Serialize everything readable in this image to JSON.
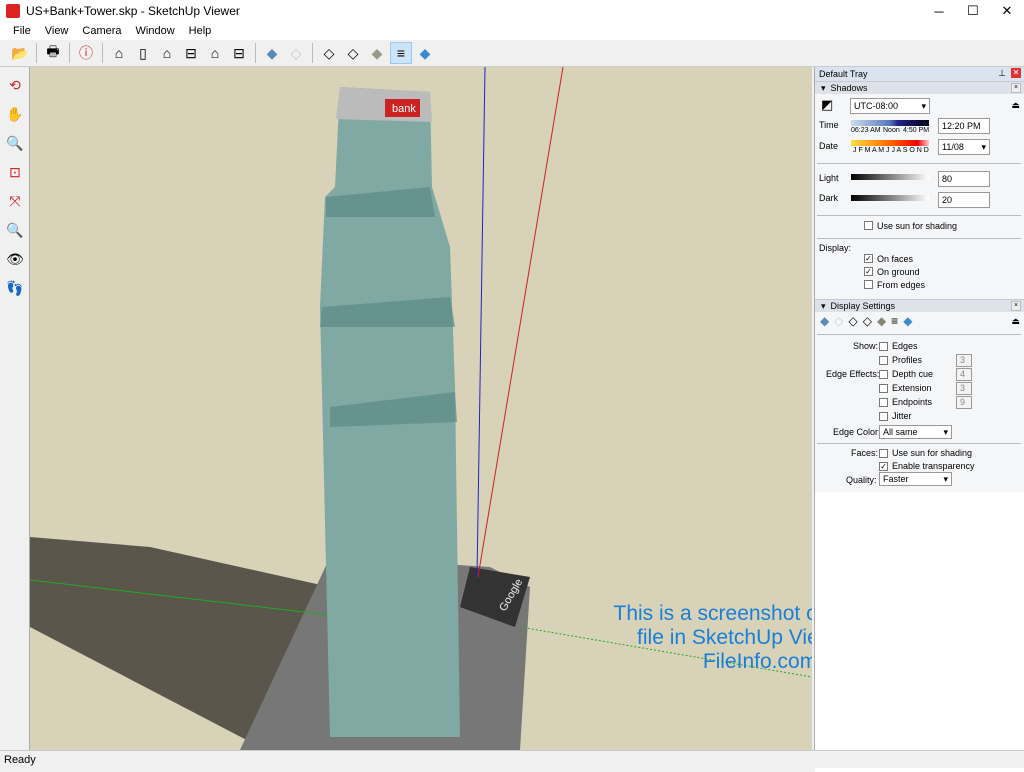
{
  "window": {
    "title": "US+Bank+Tower.skp - SketchUp Viewer",
    "minimize": "─",
    "maximize": "☐",
    "close": "✕"
  },
  "menu": [
    "File",
    "View",
    "Camera",
    "Window",
    "Help"
  ],
  "toolbar_icons": [
    "open-icon",
    "print-icon",
    "model-info-icon",
    "iso-view-icon",
    "top-view-icon",
    "front-view-icon",
    "right-view-icon",
    "back-view-icon",
    "left-view-icon",
    "xray-icon",
    "back-edges-icon",
    "wireframe-icon",
    "hidden-line-icon",
    "shaded-icon",
    "shaded-textures-icon",
    "monochrome-icon"
  ],
  "left_tools": [
    "orbit-icon",
    "pan-icon",
    "zoom-icon",
    "zoom-window-icon",
    "zoom-extents-icon",
    "previous-view-icon",
    "look-around-icon",
    "walk-icon"
  ],
  "viewport": {
    "watermark": "This is a screenshot of an .SKP file in SketchUp Viewer for FileInfo.com",
    "background": "#d7d2b8",
    "sign": "bank",
    "google_label": "Google"
  },
  "tray": {
    "title": "Default Tray",
    "shadows": {
      "header": "Shadows",
      "timezone": "UTC-08:00",
      "time_label": "Time",
      "time_start": "06:23 AM",
      "time_noon": "Noon",
      "time_end": "4:50 PM",
      "time_value": "12:20 PM",
      "time_fraction": 0.55,
      "date_label": "Date",
      "months": "J F M A M J J A S O N D",
      "date_value": "11/08",
      "light_label": "Light",
      "light_value": "80",
      "dark_label": "Dark",
      "dark_value": "20",
      "use_sun": "Use sun for shading",
      "use_sun_checked": false,
      "display_label": "Display:",
      "on_faces": "On faces",
      "on_faces_checked": true,
      "on_ground": "On ground",
      "on_ground_checked": true,
      "from_edges": "From edges",
      "from_edges_checked": false
    },
    "display": {
      "header": "Display Settings",
      "show_label": "Show:",
      "edges": "Edges",
      "edge_effects_label": "Edge Effects:",
      "profiles": "Profiles",
      "profiles_val": "3",
      "depth_cue": "Depth cue",
      "depth_cue_val": "4",
      "extension": "Extension",
      "extension_val": "3",
      "endpoints": "Endpoints",
      "endpoints_val": "9",
      "jitter": "Jitter",
      "edge_color_label": "Edge Color:",
      "edge_color": "All same",
      "faces_label": "Faces:",
      "faces_use_sun": "Use sun for shading",
      "enable_transparency": "Enable transparency",
      "quality_label": "Quality:",
      "quality": "Faster"
    }
  },
  "status": "Ready"
}
